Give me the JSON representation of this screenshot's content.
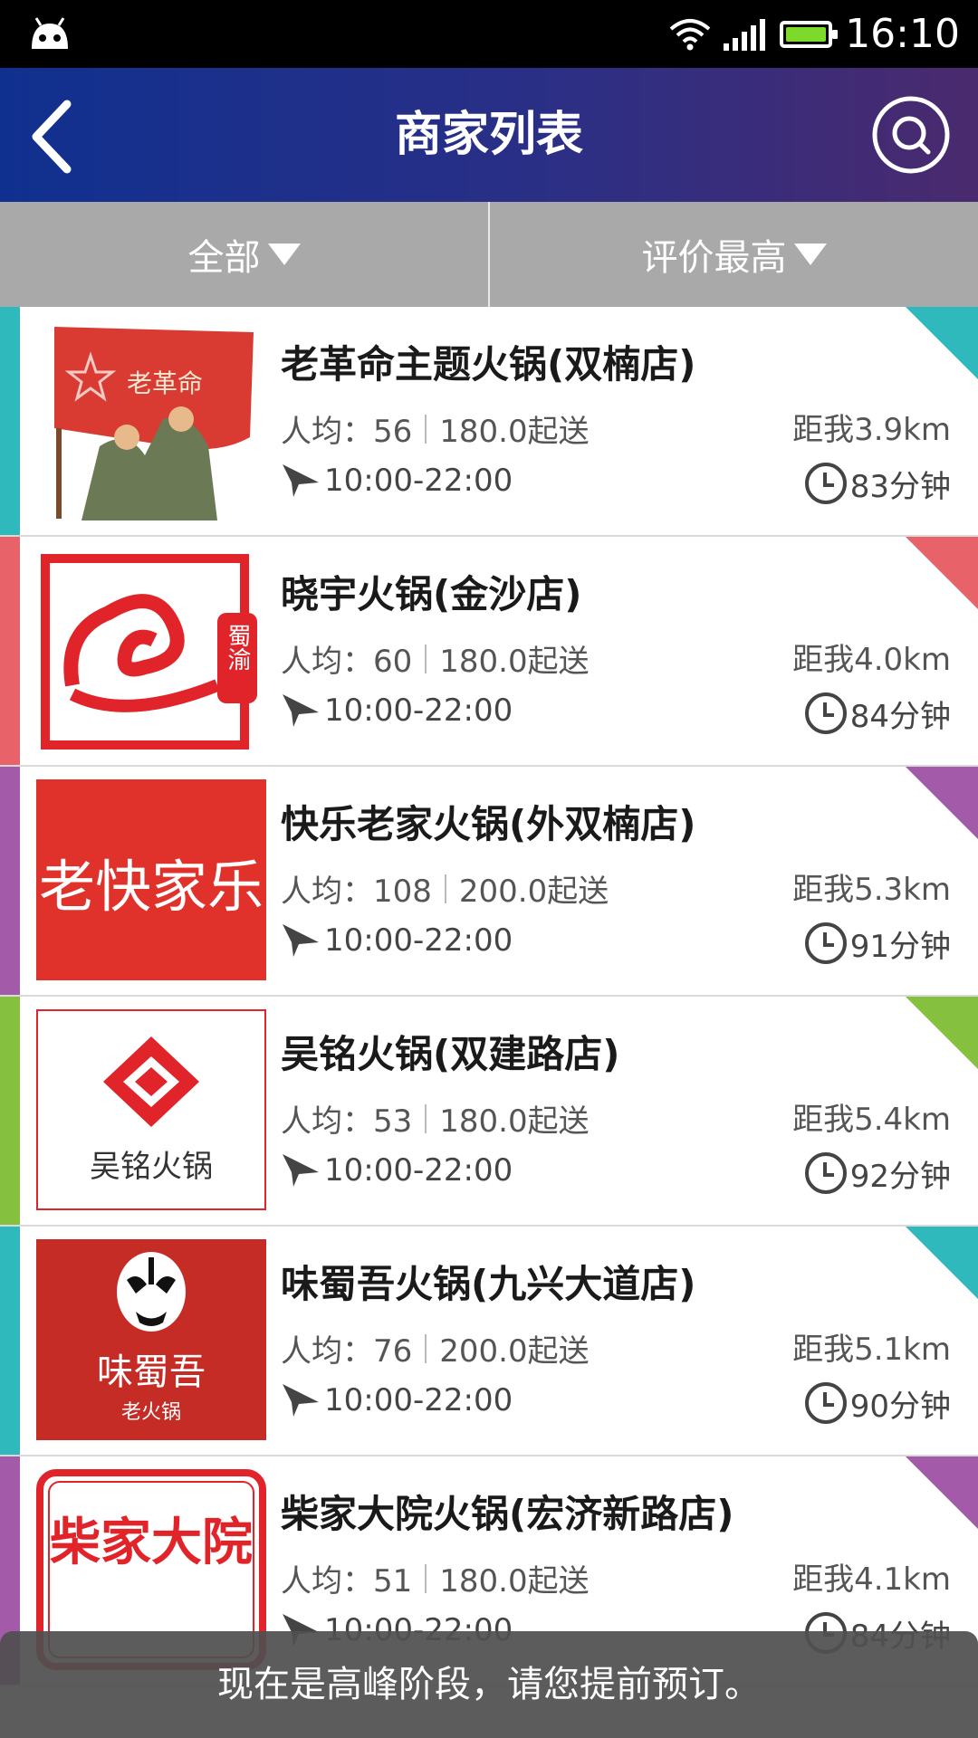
{
  "status_bar": {
    "time": "16:10"
  },
  "header": {
    "title": "商家列表"
  },
  "filters": {
    "category": "全部",
    "sort": "评价最高"
  },
  "merchants": [
    {
      "name": "老革命主题火锅(双楠店)",
      "avg_price": "人均：56",
      "min_order": "180.0起送",
      "hours": "10:00-22:00",
      "distance": "距我3.9km",
      "delivery_time": "83分钟",
      "logo_text": "老革命",
      "accent": "#2fb9bd"
    },
    {
      "name": "晓宇火锅(金沙店)",
      "avg_price": "人均：60",
      "min_order": "180.0起送",
      "hours": "10:00-22:00",
      "distance": "距我4.0km",
      "delivery_time": "84分钟",
      "logo_text": "蜀渝",
      "accent": "#e8626a"
    },
    {
      "name": "快乐老家火锅(外双楠店)",
      "avg_price": "人均：108",
      "min_order": "200.0起送",
      "hours": "10:00-22:00",
      "distance": "距我5.3km",
      "delivery_time": "91分钟",
      "logo_text": "老快家乐",
      "accent": "#a35aa8"
    },
    {
      "name": "吴铭火锅(双建路店)",
      "avg_price": "人均：53",
      "min_order": "180.0起送",
      "hours": "10:00-22:00",
      "distance": "距我5.4km",
      "delivery_time": "92分钟",
      "logo_text": "吴铭火锅",
      "accent": "#86c03f"
    },
    {
      "name": "味蜀吾火锅(九兴大道店)",
      "avg_price": "人均：76",
      "min_order": "200.0起送",
      "hours": "10:00-22:00",
      "distance": "距我5.1km",
      "delivery_time": "90分钟",
      "logo_text": "味蜀吾",
      "logo_subtext": "老火锅",
      "accent": "#2fb9bd"
    },
    {
      "name": "柴家大院火锅(宏济新路店)",
      "avg_price": "人均：51",
      "min_order": "180.0起送",
      "hours": "10:00-22:00",
      "distance": "距我4.1km",
      "delivery_time": "84分钟",
      "logo_text": "柴家大院",
      "accent": "#a35aa8"
    }
  ],
  "toast": {
    "message": "现在是高峰阶段，请您提前预订。"
  }
}
